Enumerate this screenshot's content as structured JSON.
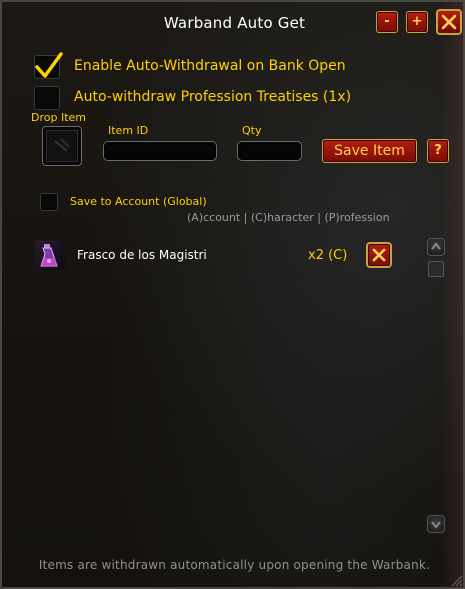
{
  "window": {
    "title": "Warband Auto Get",
    "minimize_label": "-",
    "expand_label": "+"
  },
  "options": {
    "auto_withdraw_label": "Enable Auto-Withdrawal on Bank Open",
    "auto_withdraw_checked": true,
    "treatises_label": "Auto-withdraw Profession Treatises (1x)",
    "treatises_checked": false
  },
  "add_item": {
    "drop_label": "Drop Item",
    "item_id_label": "Item ID",
    "item_id_value": "",
    "qty_label": "Qty",
    "qty_value": "",
    "save_label": "Save Item",
    "help_label": "?"
  },
  "account": {
    "save_account_label": "Save to Account (Global)",
    "save_account_checked": false,
    "legend": "(A)ccount | (C)haracter | (P)rofession"
  },
  "items": [
    {
      "name": "Frasco de los Magistri",
      "quantity": "x2 (C)",
      "icon": "potion-flask-icon"
    }
  ],
  "footer": {
    "text": "Items are withdrawn automatically upon opening the Warbank."
  },
  "colors": {
    "gold": "#ffd100",
    "button_red": "#b41d10",
    "button_border": "#caa045"
  }
}
